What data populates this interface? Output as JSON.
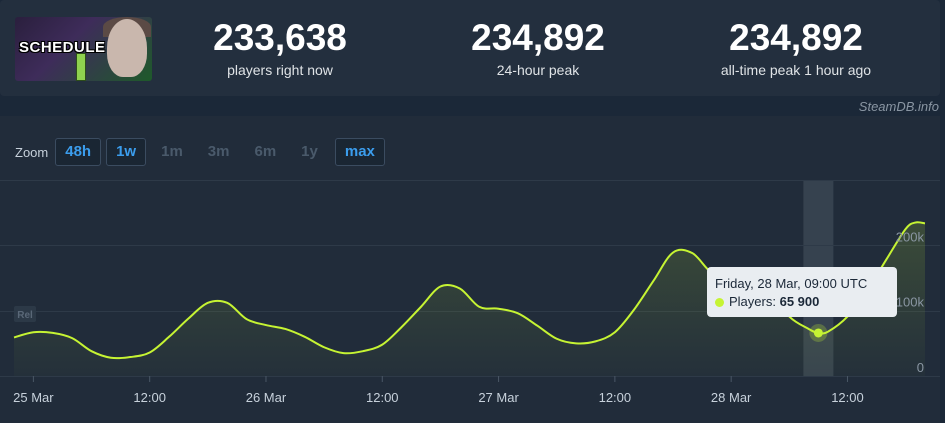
{
  "game": {
    "title": "SCHEDULE I",
    "art_icon": "game-cover-art"
  },
  "stats": [
    {
      "value": "233,638",
      "label": "players right now"
    },
    {
      "value": "234,892",
      "label": "24-hour peak"
    },
    {
      "value": "234,892",
      "label": "all-time peak 1 hour ago"
    }
  ],
  "credit": "SteamDB.info",
  "zoom": {
    "label": "Zoom",
    "options": [
      {
        "label": "48h",
        "active": true
      },
      {
        "label": "1w",
        "active": true
      },
      {
        "label": "1m",
        "active": false
      },
      {
        "label": "3m",
        "active": false
      },
      {
        "label": "6m",
        "active": false
      },
      {
        "label": "1y",
        "active": false
      },
      {
        "label": "max",
        "active": true
      }
    ]
  },
  "colors": {
    "line": "#c6f433",
    "background": "#1b2838",
    "panel": "#212c3a",
    "grid": "#2e3a48",
    "highlight": "#3a4654",
    "zoom_active": "#3b9ded"
  },
  "chart_data": {
    "type": "area",
    "series": [
      {
        "name": "Players",
        "points": [
          [
            "2025-03-24T22:00Z",
            59000
          ],
          [
            "2025-03-25T00:00Z",
            67000
          ],
          [
            "2025-03-25T02:00Z",
            66000
          ],
          [
            "2025-03-25T04:00Z",
            58000
          ],
          [
            "2025-03-25T06:00Z",
            38000
          ],
          [
            "2025-03-25T08:00Z",
            28000
          ],
          [
            "2025-03-25T10:00Z",
            29000
          ],
          [
            "2025-03-25T12:00Z",
            36000
          ],
          [
            "2025-03-25T14:00Z",
            60000
          ],
          [
            "2025-03-25T16:00Z",
            88000
          ],
          [
            "2025-03-25T18:00Z",
            112000
          ],
          [
            "2025-03-25T20:00Z",
            112000
          ],
          [
            "2025-03-25T22:00Z",
            87000
          ],
          [
            "2025-03-26T00:00Z",
            78000
          ],
          [
            "2025-03-26T02:00Z",
            72000
          ],
          [
            "2025-03-26T04:00Z",
            60000
          ],
          [
            "2025-03-26T06:00Z",
            44000
          ],
          [
            "2025-03-26T08:00Z",
            35000
          ],
          [
            "2025-03-26T10:00Z",
            38000
          ],
          [
            "2025-03-26T12:00Z",
            48000
          ],
          [
            "2025-03-26T14:00Z",
            75000
          ],
          [
            "2025-03-26T16:00Z",
            106000
          ],
          [
            "2025-03-26T18:00Z",
            137000
          ],
          [
            "2025-03-26T20:00Z",
            134000
          ],
          [
            "2025-03-26T22:00Z",
            106000
          ],
          [
            "2025-03-27T00:00Z",
            103000
          ],
          [
            "2025-03-27T02:00Z",
            96000
          ],
          [
            "2025-03-27T04:00Z",
            77000
          ],
          [
            "2025-03-27T06:00Z",
            57000
          ],
          [
            "2025-03-27T08:00Z",
            50000
          ],
          [
            "2025-03-27T10:00Z",
            53000
          ],
          [
            "2025-03-27T12:00Z",
            67000
          ],
          [
            "2025-03-27T14:00Z",
            102000
          ],
          [
            "2025-03-27T16:00Z",
            146000
          ],
          [
            "2025-03-27T18:00Z",
            189000
          ],
          [
            "2025-03-27T20:00Z",
            188000
          ],
          [
            "2025-03-27T22:00Z",
            158000
          ],
          [
            "2025-03-28T00:00Z",
            153000
          ],
          [
            "2025-03-28T02:00Z",
            151000
          ],
          [
            "2025-03-28T04:00Z",
            131000
          ],
          [
            "2025-03-28T06:00Z",
            91000
          ],
          [
            "2025-03-28T08:00Z",
            72000
          ],
          [
            "2025-03-28T09:00Z",
            65900
          ],
          [
            "2025-03-28T10:00Z",
            68000
          ],
          [
            "2025-03-28T12:00Z",
            91000
          ],
          [
            "2025-03-28T14:00Z",
            130000
          ],
          [
            "2025-03-28T16:00Z",
            178000
          ],
          [
            "2025-03-28T18:00Z",
            225000
          ],
          [
            "2025-03-28T19:00Z",
            234892
          ],
          [
            "2025-03-28T20:00Z",
            233638
          ]
        ]
      }
    ],
    "x_ticks": [
      {
        "label": "25 Mar",
        "t": "2025-03-25T00:00Z"
      },
      {
        "label": "12:00",
        "t": "2025-03-25T12:00Z"
      },
      {
        "label": "26 Mar",
        "t": "2025-03-26T00:00Z"
      },
      {
        "label": "12:00",
        "t": "2025-03-26T12:00Z"
      },
      {
        "label": "27 Mar",
        "t": "2025-03-27T00:00Z"
      },
      {
        "label": "12:00",
        "t": "2025-03-27T12:00Z"
      },
      {
        "label": "28 Mar",
        "t": "2025-03-28T00:00Z"
      },
      {
        "label": "12:00",
        "t": "2025-03-28T12:00Z"
      }
    ],
    "y_ticks": [
      {
        "label": "0",
        "value": 0
      },
      {
        "label": "100k",
        "value": 100000
      },
      {
        "label": "200k",
        "value": 200000
      }
    ],
    "xlim": [
      "2025-03-24T22:00Z",
      "2025-03-28T20:00Z"
    ],
    "ylim": [
      0,
      300000
    ],
    "grid": true,
    "corner_badge": "Rel",
    "tooltip": {
      "title": "Friday, 28 Mar, 09:00 UTC",
      "series_label": "Players:",
      "value_label": "65 900",
      "t": "2025-03-28T09:00Z",
      "value": 65900
    }
  }
}
